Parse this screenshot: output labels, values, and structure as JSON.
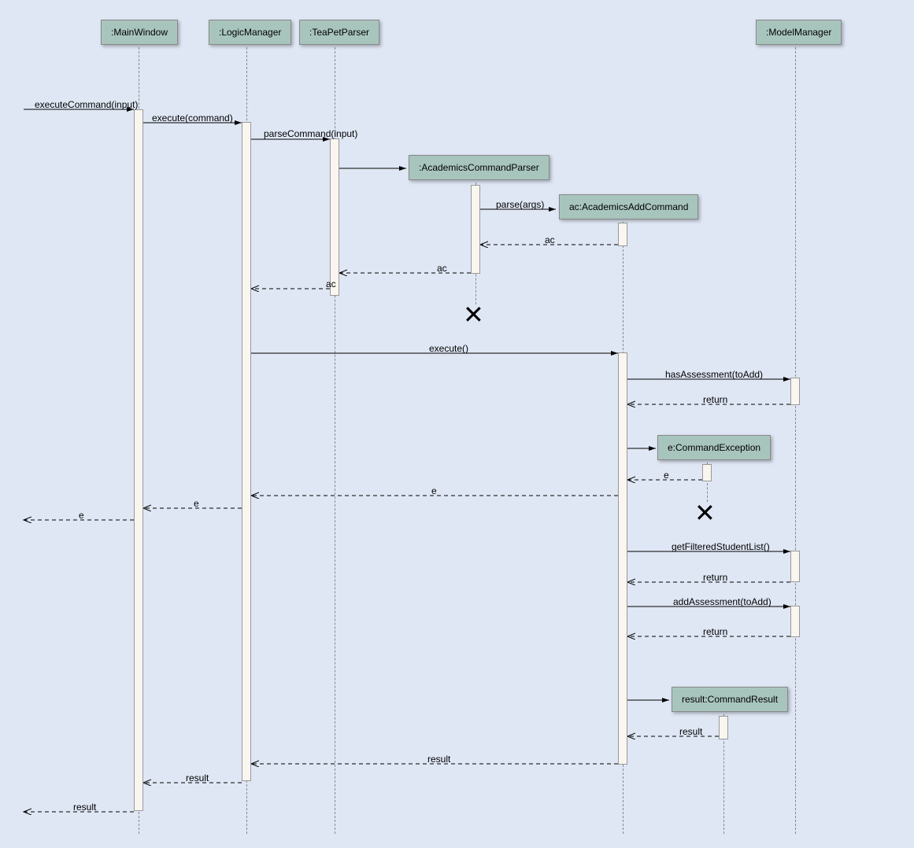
{
  "participants": {
    "mainWindow": ":MainWindow",
    "logicManager": ":LogicManager",
    "teaPetParser": ":TeaPetParser",
    "academicsCommandParser": ":AcademicsCommandParser",
    "academicsAddCommand": "ac:AcademicsAddCommand",
    "commandException": "e:CommandException",
    "commandResult": "result:CommandResult",
    "modelManager": ":ModelManager"
  },
  "messages": {
    "executeCommandInput": "executeCommand(input)",
    "executeCommand": "execute(command)",
    "parseCommandInput": "parseCommand(input)",
    "parseArgs": "parse(args)",
    "ac1": "ac",
    "ac2": "ac",
    "ac3": "ac",
    "execute": "execute()",
    "hasAssessment": "hasAssessment(toAdd)",
    "return1": "return",
    "e1": "e",
    "e2": "e",
    "e3": "e",
    "e4": "e",
    "getFilteredStudentList": "getFilteredStudentList()",
    "return2": "return",
    "addAssessment": "addAssessment(toAdd)",
    "return3": "return",
    "result1": "result",
    "result2": "result",
    "result3": "result",
    "result4": "result"
  }
}
